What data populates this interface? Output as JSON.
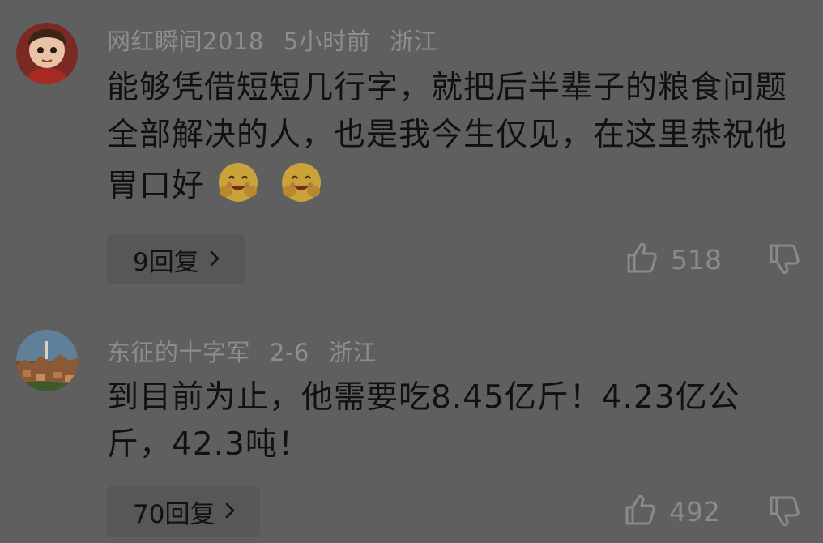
{
  "comments": [
    {
      "username": "网红瞬间2018",
      "time": "5小时前",
      "location": "浙江",
      "text": "能够凭借短短几行字，就把后半辈子的粮食问题全部解决的人，也是我今生仅见，在这里恭祝他胃口好",
      "emojis": [
        "hugging-face-emoji",
        "hugging-face-emoji"
      ],
      "replies_label": "9回复",
      "likes": "518"
    },
    {
      "username": "东征的十字军",
      "time": "2-6",
      "location": "浙江",
      "text": "到目前为止，他需要吃8.45亿斤！4.23亿公斤，42.3吨！",
      "replies_label": "70回复",
      "likes": "492"
    }
  ],
  "colors": {
    "background": "#5f5f5f",
    "meta_text": "#8d8d8d",
    "body_text": "#111111",
    "reply_button_bg": "#575757"
  }
}
